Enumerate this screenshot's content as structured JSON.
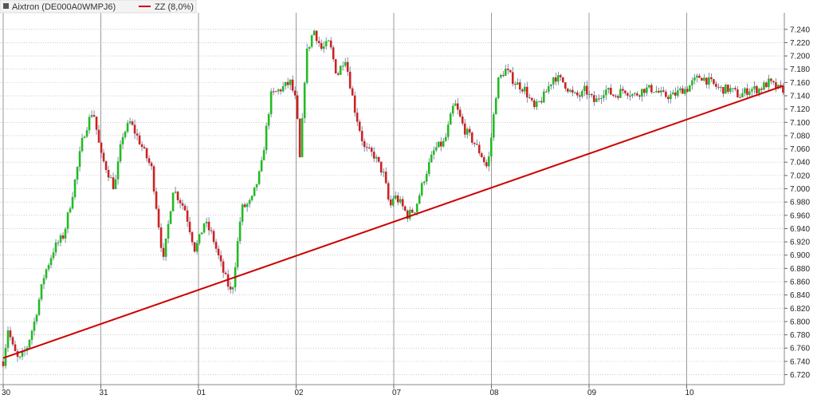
{
  "legend": {
    "instrument": "Aixtron (DE000A0WMPJ6)",
    "indicator": "ZZ (8,0%)",
    "instrument_color": "#555555",
    "indicator_color": "#cc0000"
  },
  "chart_data": {
    "type": "line",
    "title": "",
    "xlabel": "",
    "ylabel": "",
    "ylim": [
      6.705,
      7.265
    ],
    "y_ticks": [
      "7.240",
      "7.220",
      "7.200",
      "7.180",
      "7.160",
      "7.140",
      "7.120",
      "7.100",
      "7.080",
      "7.060",
      "7.040",
      "7.020",
      "7.000",
      "6.980",
      "6.960",
      "6.940",
      "6.920",
      "6.900",
      "6.880",
      "6.860",
      "6.840",
      "6.820",
      "6.800",
      "6.780",
      "6.760",
      "6.740",
      "6.720"
    ],
    "x_ticks": [
      "30",
      "31",
      "01",
      "02",
      "07",
      "08",
      "09",
      "10"
    ],
    "grid": true,
    "up_color": "#22bb22",
    "down_color": "#cc2222",
    "series": [
      {
        "name": "Aixtron (DE000A0WMPJ6)",
        "kind": "price",
        "x": [
          0,
          0.05,
          0.1,
          0.16,
          0.24,
          0.32,
          0.42,
          0.52,
          0.62,
          0.72,
          0.82,
          0.92,
          1.0,
          1.06,
          1.14,
          1.22,
          1.3,
          1.4,
          1.52,
          1.64,
          1.74,
          1.86,
          1.96,
          2.0,
          2.06,
          2.14,
          2.24,
          2.34,
          2.44,
          2.54,
          2.64,
          2.74,
          2.84,
          2.94,
          3.0,
          3.04,
          3.1,
          3.18,
          3.26,
          3.34,
          3.42,
          3.5,
          3.6,
          3.7,
          3.8,
          3.9,
          3.96,
          4.0,
          4.06,
          4.14,
          4.22,
          4.32,
          4.42,
          4.52,
          4.62,
          4.72,
          4.82,
          4.9,
          4.96,
          5.0,
          5.06,
          5.14,
          5.24,
          5.34,
          5.44,
          5.54,
          5.64,
          5.74,
          5.84,
          5.92,
          5.96,
          6.0,
          6.06,
          6.16,
          6.26,
          6.36,
          6.46,
          6.56,
          6.66,
          6.76,
          6.86,
          6.96,
          7.0,
          7.06,
          7.14,
          7.24,
          7.34,
          7.44,
          7.54,
          7.64,
          7.74,
          7.84,
          7.94,
          7.99
        ],
        "values": [
          6.74,
          6.79,
          6.76,
          6.74,
          6.76,
          6.8,
          6.87,
          6.91,
          6.93,
          7.0,
          7.08,
          7.12,
          7.05,
          7.03,
          7.0,
          7.08,
          7.1,
          7.07,
          7.03,
          6.89,
          7.0,
          6.97,
          6.91,
          6.92,
          6.95,
          6.93,
          6.88,
          6.84,
          6.97,
          6.98,
          7.03,
          7.14,
          7.15,
          7.16,
          7.13,
          7.04,
          7.2,
          7.24,
          7.21,
          7.22,
          7.17,
          7.2,
          7.12,
          7.06,
          7.05,
          7.02,
          6.97,
          6.99,
          6.98,
          6.96,
          6.97,
          7.02,
          7.06,
          7.07,
          7.13,
          7.09,
          7.07,
          7.05,
          7.03,
          7.08,
          7.16,
          7.18,
          7.16,
          7.15,
          7.12,
          7.14,
          7.17,
          7.16,
          7.14,
          7.14,
          7.15,
          7.14,
          7.13,
          7.15,
          7.14,
          7.15,
          7.14,
          7.15,
          7.15,
          7.14,
          7.14,
          7.15,
          7.15,
          7.16,
          7.17,
          7.16,
          7.15,
          7.15,
          7.14,
          7.15,
          7.15,
          7.16,
          7.15,
          7.15
        ]
      },
      {
        "name": "ZZ (8,0%)",
        "kind": "line",
        "x": [
          0,
          7.99
        ],
        "values": [
          6.745,
          7.155
        ]
      }
    ]
  }
}
